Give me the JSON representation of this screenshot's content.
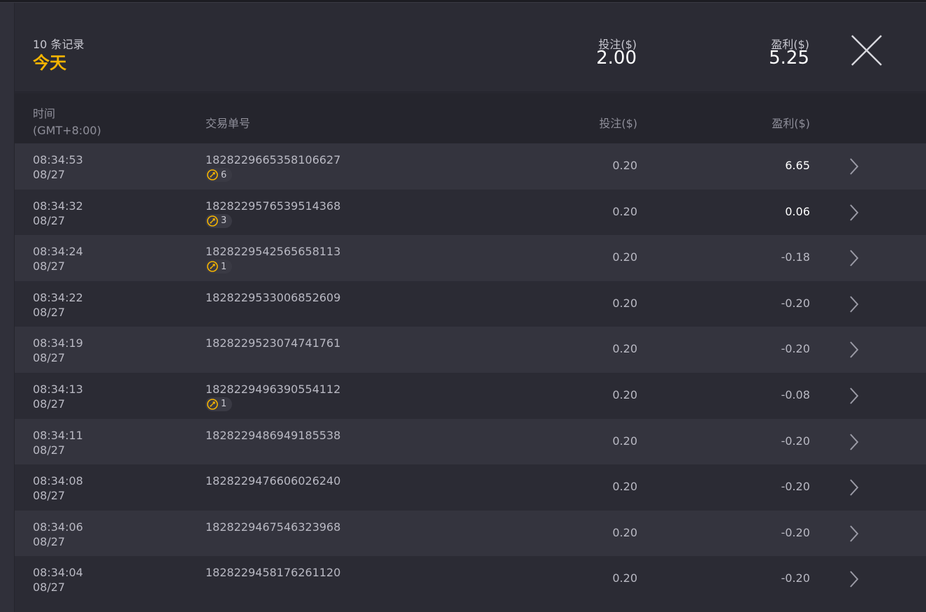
{
  "summary": {
    "record_count": "10 条记录",
    "period": "今天",
    "bet_label": "投注($)",
    "bet_value": "2.00",
    "profit_label": "盈利($)",
    "profit_value": "5.25"
  },
  "table": {
    "headers": {
      "time": "时间",
      "timezone": "(GMT+8:00)",
      "order_id": "交易单号",
      "bet": "投注($)",
      "profit": "盈利($)"
    },
    "rows": [
      {
        "time": "08:34:53",
        "date": "08/27",
        "order_id": "1828229665358106627",
        "free_spins": "6",
        "bet": "0.20",
        "profit": "6.65"
      },
      {
        "time": "08:34:32",
        "date": "08/27",
        "order_id": "1828229576539514368",
        "free_spins": "3",
        "bet": "0.20",
        "profit": "0.06"
      },
      {
        "time": "08:34:24",
        "date": "08/27",
        "order_id": "1828229542565658113",
        "free_spins": "1",
        "bet": "0.20",
        "profit": "-0.18"
      },
      {
        "time": "08:34:22",
        "date": "08/27",
        "order_id": "1828229533006852609",
        "free_spins": "",
        "bet": "0.20",
        "profit": "-0.20"
      },
      {
        "time": "08:34:19",
        "date": "08/27",
        "order_id": "1828229523074741761",
        "free_spins": "",
        "bet": "0.20",
        "profit": "-0.20"
      },
      {
        "time": "08:34:13",
        "date": "08/27",
        "order_id": "1828229496390554112",
        "free_spins": "1",
        "bet": "0.20",
        "profit": "-0.08"
      },
      {
        "time": "08:34:11",
        "date": "08/27",
        "order_id": "1828229486949185538",
        "free_spins": "",
        "bet": "0.20",
        "profit": "-0.20"
      },
      {
        "time": "08:34:08",
        "date": "08/27",
        "order_id": "1828229476606026240",
        "free_spins": "",
        "bet": "0.20",
        "profit": "-0.20"
      },
      {
        "time": "08:34:06",
        "date": "08/27",
        "order_id": "1828229467546323968",
        "free_spins": "",
        "bet": "0.20",
        "profit": "-0.20"
      },
      {
        "time": "08:34:04",
        "date": "08/27",
        "order_id": "1828229458176261120",
        "free_spins": "",
        "bet": "0.20",
        "profit": "-0.20"
      }
    ]
  },
  "icons": {
    "close": "close-icon",
    "row_arrow": "chevron-right-icon",
    "free_spin": "free-spin-icon"
  },
  "colors": {
    "accent": "#f5b400",
    "positive_profit": "#ffffff"
  }
}
